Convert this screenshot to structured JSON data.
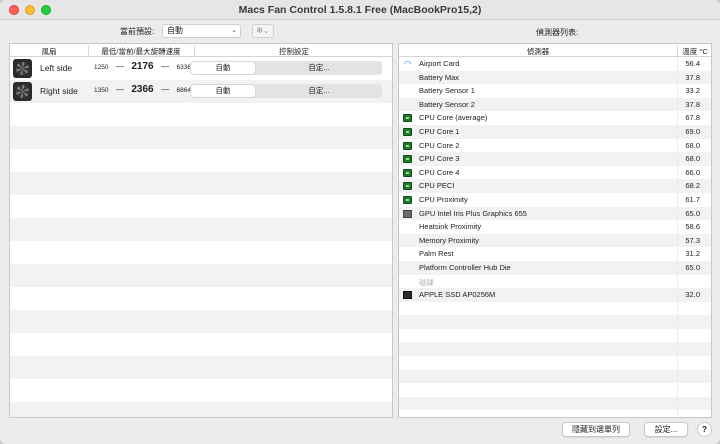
{
  "window": {
    "title": "Macs Fan Control 1.5.8.1 Free (MacBookPro15,2)"
  },
  "toolbar": {
    "preset_label": "當前預設:",
    "preset_value": "自動",
    "preset_chevron": "⌄",
    "gear_glyph": "✻⌄",
    "sensors_list_label": "偵測器列表:"
  },
  "fans_table": {
    "headers": {
      "fan": "風扇",
      "speed": "最低/當前/最大旋轉速度",
      "control": "控制設定"
    },
    "rows": [
      {
        "name": "Left side",
        "min": "1250",
        "current": "2176",
        "max": "6336",
        "auto_label": "自動",
        "custom_label": "自定..."
      },
      {
        "name": "Right side",
        "min": "1350",
        "current": "2366",
        "max": "6864",
        "auto_label": "自動",
        "custom_label": "自定..."
      }
    ],
    "dash": "—"
  },
  "sensors_table": {
    "headers": {
      "sensor": "偵測器",
      "temp": "溫度 °C"
    },
    "rows": [
      {
        "icon": "wifi-icon",
        "name": "Airport Card",
        "value": "56.4",
        "muted": false
      },
      {
        "icon": "",
        "name": "Battery Max",
        "value": "37.8",
        "muted": false
      },
      {
        "icon": "",
        "name": "Battery Sensor 1",
        "value": "33.2",
        "muted": false
      },
      {
        "icon": "",
        "name": "Battery Sensor 2",
        "value": "37.8",
        "muted": false
      },
      {
        "icon": "chip-icon",
        "name": "CPU Core (average)",
        "value": "67.8",
        "muted": false
      },
      {
        "icon": "chip-icon",
        "name": "CPU Core 1",
        "value": "69.0",
        "muted": false
      },
      {
        "icon": "chip-icon",
        "name": "CPU Core 2",
        "value": "68.0",
        "muted": false
      },
      {
        "icon": "chip-icon",
        "name": "CPU Core 3",
        "value": "68.0",
        "muted": false
      },
      {
        "icon": "chip-icon",
        "name": "CPU Core 4",
        "value": "66.0",
        "muted": false
      },
      {
        "icon": "chip-icon",
        "name": "CPU PECI",
        "value": "68.2",
        "muted": false
      },
      {
        "icon": "chip-icon",
        "name": "CPU Proximity",
        "value": "61.7",
        "muted": false
      },
      {
        "icon": "gpu-icon",
        "name": "GPU Intel Iris Plus Graphics 655",
        "value": "65.0",
        "muted": false
      },
      {
        "icon": "",
        "name": "Heatsink Proximity",
        "value": "58.6",
        "muted": false
      },
      {
        "icon": "",
        "name": "Memory Proximity",
        "value": "57.3",
        "muted": false
      },
      {
        "icon": "",
        "name": "Palm Rest",
        "value": "31.2",
        "muted": false
      },
      {
        "icon": "",
        "name": "Platform Controller Hub Die",
        "value": "65.0",
        "muted": false
      },
      {
        "icon": "",
        "name": "磁碟",
        "value": "",
        "muted": true
      },
      {
        "icon": "ssd-icon",
        "name": "APPLE SSD AP0256M",
        "value": "32.0",
        "muted": false
      }
    ]
  },
  "footer": {
    "hide_to_menu": "隱藏到選單列",
    "settings": "設定...",
    "help": "?"
  },
  "colors": {
    "wifi": "#1b84f0",
    "chip": "#1d7a2c",
    "close": "#ff5f57",
    "minimize": "#febc2e",
    "maximize": "#28c840"
  }
}
